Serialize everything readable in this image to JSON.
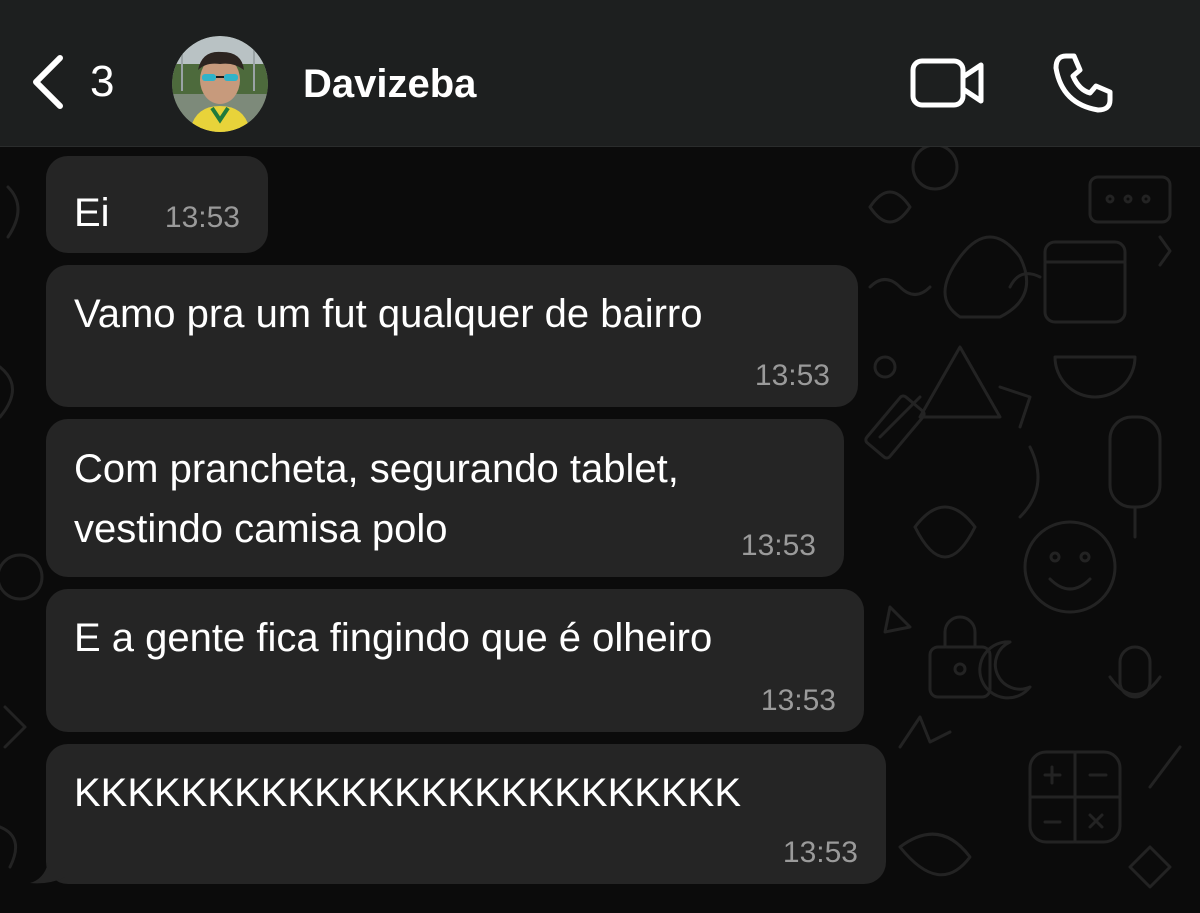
{
  "header": {
    "back_count": "3",
    "contact_name": "Davizeba"
  },
  "messages": [
    {
      "text": "Ei",
      "time": "13:53"
    },
    {
      "text": "Vamo pra um fut qualquer de bairro",
      "time": "13:53"
    },
    {
      "lines": [
        "Com prancheta, segurando tablet,",
        "vestindo camisa polo"
      ],
      "time": "13:53"
    },
    {
      "text": "E a gente fica fingindo que é olheiro",
      "time": "13:53"
    },
    {
      "text": "KKKKKKKKKKKKKKKKKKKKKKKKK",
      "time": "13:53"
    }
  ],
  "colors": {
    "background": "#0b0b0b",
    "header": "#1d1f1f",
    "bubble": "#252525",
    "timestamp": "#9a9a9a",
    "text": "#ffffff"
  },
  "icons": {
    "back": "chevron-left-icon",
    "video": "video-camera-icon",
    "call": "phone-icon"
  }
}
